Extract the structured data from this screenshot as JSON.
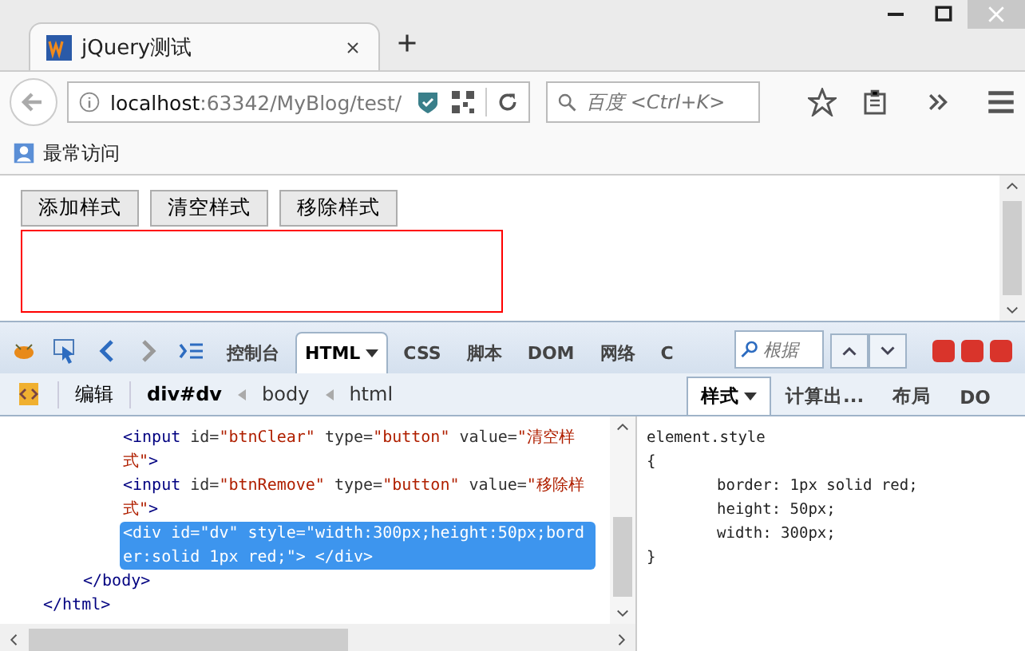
{
  "window": {
    "tab": {
      "title": "jQuery测试",
      "selected": true
    }
  },
  "navbar": {
    "url_host": "localhost",
    "url_path": ":63342/MyBlog/test/",
    "search_placeholder": "百度 <Ctrl+K>"
  },
  "bookmarks": [
    {
      "label": "最常访问"
    }
  ],
  "page": {
    "buttons": [
      "添加样式",
      "清空样式",
      "移除样式"
    ]
  },
  "devtools": {
    "tabs": [
      {
        "label": "控制台",
        "selected": false,
        "dropdown": false
      },
      {
        "label": "HTML",
        "selected": true,
        "dropdown": true
      },
      {
        "label": "CSS",
        "selected": false,
        "dropdown": false
      },
      {
        "label": "脚本",
        "selected": false,
        "dropdown": false
      },
      {
        "label": "DOM",
        "selected": false,
        "dropdown": false
      },
      {
        "label": "网络",
        "selected": false,
        "dropdown": false
      },
      {
        "label": "C",
        "selected": false,
        "dropdown": false
      }
    ],
    "search_placeholder": "根据",
    "edit_button": "编辑",
    "breadcrumbs": [
      {
        "label": "div#dv",
        "selected": true
      },
      {
        "label": "body",
        "selected": false
      },
      {
        "label": "html",
        "selected": false
      }
    ],
    "side_tabs": [
      {
        "label": "样式",
        "selected": true,
        "dropdown": true
      },
      {
        "label": "计算出...",
        "selected": false,
        "dropdown": false
      },
      {
        "label": "布局",
        "selected": false,
        "dropdown": false
      },
      {
        "label": "DO",
        "selected": false,
        "dropdown": false
      }
    ],
    "tree": [
      {
        "close": "</html>",
        "children": [
          {
            "close": "</body>",
            "children": [
              {
                "selected": false,
                "tokens": [
                  {
                    "kind": "tag",
                    "text": "<input"
                  },
                  {
                    "kind": "attr",
                    "text": " id="
                  },
                  {
                    "kind": "value",
                    "text": "\"btnClear\""
                  },
                  {
                    "kind": "attr",
                    "text": " type="
                  },
                  {
                    "kind": "value",
                    "text": "\"button\""
                  },
                  {
                    "kind": "attr",
                    "text": " value="
                  },
                  {
                    "kind": "value",
                    "text": "\"清空样式\""
                  },
                  {
                    "kind": "tag",
                    "text": ">"
                  }
                ]
              },
              {
                "selected": false,
                "tokens": [
                  {
                    "kind": "tag",
                    "text": "<input"
                  },
                  {
                    "kind": "attr",
                    "text": " id="
                  },
                  {
                    "kind": "value",
                    "text": "\"btnRemove\""
                  },
                  {
                    "kind": "attr",
                    "text": " type="
                  },
                  {
                    "kind": "value",
                    "text": "\"button\""
                  },
                  {
                    "kind": "attr",
                    "text": " value="
                  },
                  {
                    "kind": "value",
                    "text": "\"移除样式\""
                  },
                  {
                    "kind": "tag",
                    "text": ">"
                  }
                ]
              },
              {
                "selected": true,
                "tokens": [
                  {
                    "kind": "tag",
                    "text": "<div"
                  },
                  {
                    "kind": "attr",
                    "text": " id="
                  },
                  {
                    "kind": "value",
                    "text": "\"dv\""
                  },
                  {
                    "kind": "attr",
                    "text": " style="
                  },
                  {
                    "kind": "value",
                    "text": "\"width:300px;height:50px;border:solid 1px red;\""
                  },
                  {
                    "kind": "tag",
                    "text": "> </div>"
                  }
                ]
              }
            ]
          }
        ]
      }
    ],
    "style_rule": {
      "selector": "element.style",
      "open": "{",
      "declarations": [
        "border: 1px solid red;",
        "height: 50px;",
        "width: 300px;"
      ],
      "close": "}"
    }
  }
}
